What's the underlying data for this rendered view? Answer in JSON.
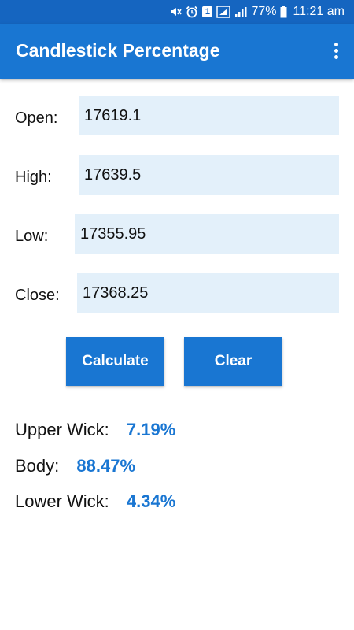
{
  "status_bar": {
    "battery": "77%",
    "time": "11:21 am",
    "notification_badge": "1",
    "icons": [
      "mute-icon",
      "alarm-icon",
      "notification-badge-icon",
      "signal-box-icon",
      "signal-bars-icon",
      "battery-icon"
    ]
  },
  "app_bar": {
    "title": "Candlestick Percentage",
    "menu_icon": "overflow-menu-icon"
  },
  "form": {
    "open": {
      "label": "Open:",
      "value": "17619.1"
    },
    "high": {
      "label": "High:",
      "value": "17639.5"
    },
    "low": {
      "label": "Low:",
      "value": "17355.95"
    },
    "close": {
      "label": "Close:",
      "value": "17368.25"
    }
  },
  "buttons": {
    "calculate": "Calculate",
    "clear": "Clear"
  },
  "results": {
    "upper_wick": {
      "label": "Upper Wick:",
      "value": "7.19%"
    },
    "body": {
      "label": "Body:",
      "value": "88.47%"
    },
    "lower_wick": {
      "label": "Lower Wick:",
      "value": "4.34%"
    }
  },
  "colors": {
    "status_bar": "#1565c0",
    "app_bar": "#1976d2",
    "accent": "#1976d2",
    "input_background": "#e3f0fa"
  }
}
